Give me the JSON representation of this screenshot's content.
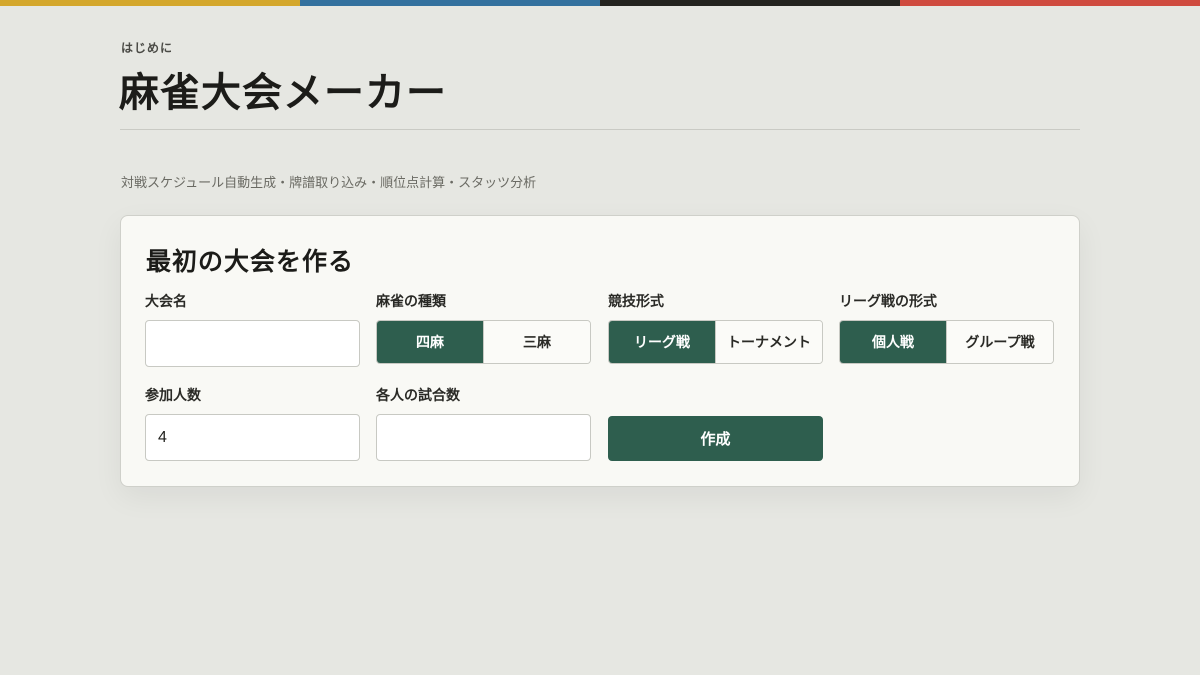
{
  "colors": {
    "topbar": [
      "#d4a72c",
      "#34719e",
      "#24241f",
      "#cf4b3f"
    ],
    "accent": "#2e5e4e",
    "background": "#e6e7e2"
  },
  "header": {
    "eyebrow": "はじめに",
    "title": "麻雀大会メーカー",
    "subtitle": "対戦スケジュール自動生成・牌譜取り込み・順位点計算・スタッツ分析"
  },
  "form": {
    "title": "最初の大会を作る",
    "tournament_name": {
      "label": "大会名",
      "value": ""
    },
    "mahjong_type": {
      "label": "麻雀の種類",
      "options": [
        "四麻",
        "三麻"
      ],
      "selected": "四麻"
    },
    "competition_format": {
      "label": "競技形式",
      "options": [
        "リーグ戦",
        "トーナメント"
      ],
      "selected": "リーグ戦"
    },
    "league_format": {
      "label": "リーグ戦の形式",
      "options": [
        "個人戦",
        "グループ戦"
      ],
      "selected": "個人戦"
    },
    "participants": {
      "label": "参加人数",
      "value": "4"
    },
    "games_per_person": {
      "label": "各人の試合数",
      "value": ""
    },
    "create_label": "作成"
  }
}
